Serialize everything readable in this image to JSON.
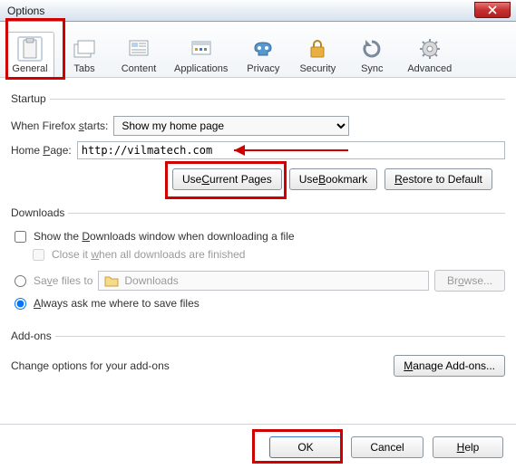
{
  "window": {
    "title": "Options"
  },
  "tabs": {
    "general": {
      "label": "General",
      "selected": true
    },
    "tabs": {
      "label": "Tabs"
    },
    "content": {
      "label": "Content"
    },
    "applications": {
      "label": "Applications"
    },
    "privacy": {
      "label": "Privacy"
    },
    "security": {
      "label": "Security"
    },
    "sync": {
      "label": "Sync"
    },
    "advanced": {
      "label": "Advanced"
    }
  },
  "startup": {
    "legend": "Startup",
    "when_label_pre": "When Firefox ",
    "when_label_u": "s",
    "when_label_post": "tarts:",
    "when_value": "Show my home page",
    "homepage_label_pre": "Home ",
    "homepage_label_u": "P",
    "homepage_label_post": "age:",
    "homepage_value": "http://vilmatech.com",
    "btn_current_pre": "Use ",
    "btn_current_u": "C",
    "btn_current_post": "urrent Pages",
    "btn_bookmark_pre": "Use ",
    "btn_bookmark_u": "B",
    "btn_bookmark_post": "ookmark",
    "btn_restore_pre": "",
    "btn_restore_u": "R",
    "btn_restore_post": "estore to Default"
  },
  "downloads": {
    "legend": "Downloads",
    "show_window_pre": "Show the ",
    "show_window_u": "D",
    "show_window_post": "ownloads window when downloading a file",
    "close_pre": "Close it ",
    "close_u": "w",
    "close_post": "hen all downloads are finished",
    "save_pre": "Sa",
    "save_u": "v",
    "save_post": "e files to",
    "save_path": "Downloads",
    "browse_pre": "Br",
    "browse_u": "o",
    "browse_post": "wse...",
    "ask_pre": "",
    "ask_u": "A",
    "ask_post": "lways ask me where to save files"
  },
  "addons": {
    "legend": "Add-ons",
    "desc": "Change options for your add-ons",
    "manage_pre": "",
    "manage_u": "M",
    "manage_post": "anage Add-ons..."
  },
  "footer": {
    "ok": "OK",
    "cancel": "Cancel",
    "help_u": "H",
    "help_post": "elp"
  }
}
